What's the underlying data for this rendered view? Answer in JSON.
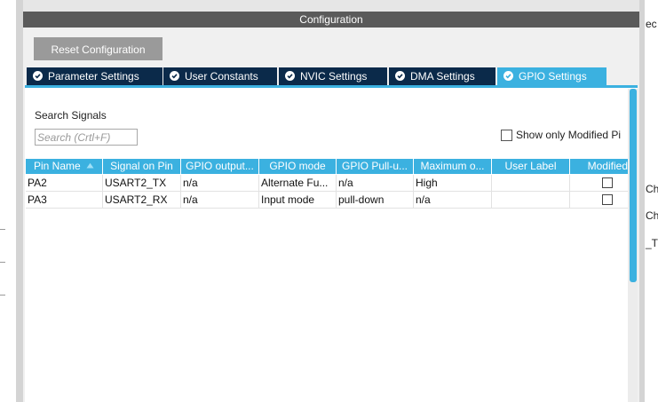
{
  "window": {
    "title": "Configuration"
  },
  "toolbar": {
    "reset_label": "Reset Configuration"
  },
  "tabs": [
    {
      "label": "Parameter Settings",
      "active": false
    },
    {
      "label": "User Constants",
      "active": false
    },
    {
      "label": "NVIC Settings",
      "active": false
    },
    {
      "label": "DMA Settings",
      "active": false
    },
    {
      "label": "GPIO Settings",
      "active": true
    }
  ],
  "search": {
    "label": "Search Signals",
    "placeholder": "Search (Crtl+F)",
    "value": ""
  },
  "filter": {
    "modified_label": "Show only Modified Pi",
    "checked": false
  },
  "table": {
    "columns": [
      "Pin Name",
      "Signal on Pin",
      "GPIO output...",
      "GPIO mode",
      "GPIO Pull-u...",
      "Maximum o...",
      "User Label",
      "Modified"
    ],
    "sort_column": "Pin Name",
    "rows": [
      {
        "pin": "PA2",
        "signal": "USART2_TX",
        "output": "n/a",
        "mode": "Alternate Fu...",
        "pull": "n/a",
        "max": "High",
        "label": "",
        "modified": false
      },
      {
        "pin": "PA3",
        "signal": "USART2_RX",
        "output": "n/a",
        "mode": "Input mode",
        "pull": "pull-down",
        "max": "n/a",
        "label": "",
        "modified": false
      }
    ]
  },
  "side_fragments": [
    "ec",
    "Ch",
    "Ch",
    "_T"
  ],
  "colors": {
    "accent": "#3bb1e0",
    "tab_dark": "#0b2a4a",
    "title_bar": "#5a5a5a",
    "button": "#9a9a9a"
  }
}
